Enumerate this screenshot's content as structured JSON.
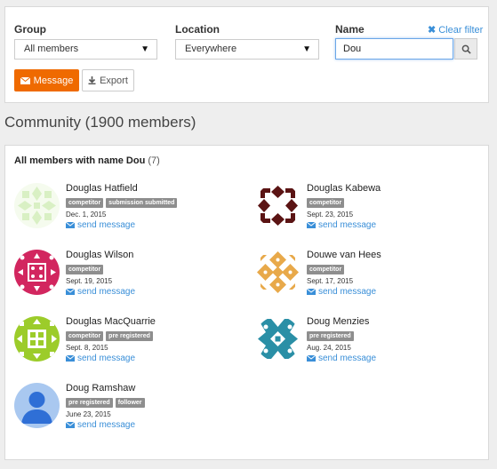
{
  "filters": {
    "group_label": "Group",
    "group_value": "All members",
    "location_label": "Location",
    "location_value": "Everywhere",
    "name_label": "Name",
    "name_value": "Dou",
    "clear_filter": "Clear filter"
  },
  "actions": {
    "message": "Message",
    "export": "Export"
  },
  "community": {
    "title": "Community (1900 members)",
    "list_heading": "All members with name Dou",
    "list_count": "(7)"
  },
  "send_message": "send message",
  "members": [
    {
      "name": "Douglas Hatfield",
      "badges": [
        "competitor",
        "submission submitted"
      ],
      "date": "Dec. 1, 2015",
      "avatar": "hatfield"
    },
    {
      "name": "Douglas Kabewa",
      "badges": [
        "competitor"
      ],
      "date": "Sept. 23, 2015",
      "avatar": "kabewa"
    },
    {
      "name": "Douglas Wilson",
      "badges": [
        "competitor"
      ],
      "date": "Sept. 19, 2015",
      "avatar": "wilson"
    },
    {
      "name": "Douwe van Hees",
      "badges": [
        "competitor"
      ],
      "date": "Sept. 17, 2015",
      "avatar": "vanhees"
    },
    {
      "name": "Douglas MacQuarrie",
      "badges": [
        "competitor",
        "pre registered"
      ],
      "date": "Sept. 8, 2015",
      "avatar": "macquarrie"
    },
    {
      "name": "Doug Menzies",
      "badges": [
        "pre registered"
      ],
      "date": "Aug. 24, 2015",
      "avatar": "menzies"
    },
    {
      "name": "Doug Ramshaw",
      "badges": [
        "pre registered",
        "follower"
      ],
      "date": "June 23, 2015",
      "avatar": "ramshaw"
    }
  ],
  "colors": {
    "accent": "#ef6a00",
    "link": "#3a8fd8",
    "badge": "#8e8e8e"
  }
}
